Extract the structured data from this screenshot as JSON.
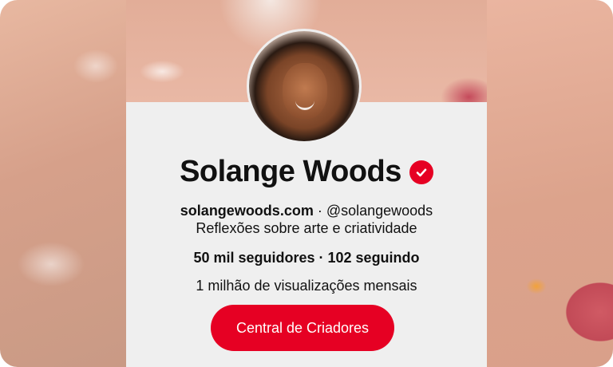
{
  "profile": {
    "name": "Solange Woods",
    "website": "solangewoods.com",
    "separator": " · ",
    "handle": "@solangewoods",
    "bio": "Reflexões sobre arte e criatividade",
    "stats": "50 mil seguidores · 102 seguindo",
    "monthly_views": "1 milhão de visualizações mensais"
  },
  "cta": {
    "label": "Central de Criadores"
  },
  "icons": {
    "verified": "verified-check-icon"
  },
  "colors": {
    "accent": "#e60023",
    "panel": "#efefef",
    "text": "#111111"
  }
}
